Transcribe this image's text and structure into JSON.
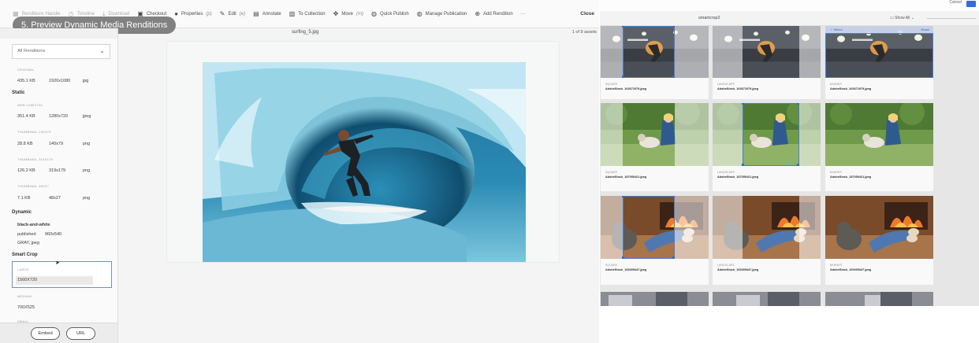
{
  "toolbar": {
    "items": [
      {
        "icon": "grid-icon",
        "label": "Renditions Handle",
        "faded": true
      },
      {
        "icon": "clock-icon",
        "label": "Timeline",
        "faded": true
      },
      {
        "icon": "download-icon",
        "label": "Download",
        "faded": true
      },
      {
        "icon": "lock-icon",
        "label": "Checkout",
        "faded": false
      },
      {
        "icon": "info-icon",
        "label": "Properties",
        "shortcut": "(p)",
        "faded": false
      },
      {
        "icon": "pencil-icon",
        "label": "Edit",
        "shortcut": "(e)",
        "faded": false
      },
      {
        "icon": "comment-icon",
        "label": "Annotate",
        "faded": false
      },
      {
        "icon": "collection-icon",
        "label": "To Collection",
        "faded": false
      },
      {
        "icon": "move-icon",
        "label": "Move",
        "shortcut": "(m)",
        "faded": false
      },
      {
        "icon": "publish-icon",
        "label": "Quick Publish",
        "faded": false
      },
      {
        "icon": "manage-publish-icon",
        "label": "Manage Publication",
        "faded": false
      },
      {
        "icon": "plus-circle-icon",
        "label": "Add Rendition",
        "faded": false
      },
      {
        "icon": "more-icon",
        "label": "···",
        "faded": false
      }
    ],
    "close_label": "Close"
  },
  "caption": "5. Preview Dynamic Media Renditions",
  "preview": {
    "filename": "surfing_5.jpg",
    "counter": "1 of 9 assets"
  },
  "sidebar": {
    "select_label": "All Renditions",
    "original_label": "ORIGINAL",
    "original": {
      "size": "435.1 KB",
      "dims": "1920x1080",
      "type": "jpg"
    },
    "static_heading": "Static",
    "static": [
      {
        "label": "WEB 1280X720",
        "size": "351.4 KB",
        "dims": "1280x720",
        "type": "jpeg"
      },
      {
        "label": "THUMBNAIL 140X79",
        "size": "28.8 KB",
        "dims": "140x79",
        "type": "png"
      },
      {
        "label": "THUMBNAIL 319X179",
        "size": "126.2 KB",
        "dims": "319x179",
        "type": "png"
      },
      {
        "label": "THUMBNAIL 48X27",
        "size": "7.1 KB",
        "dims": "48x27",
        "type": "png"
      }
    ],
    "dynamic_heading": "Dynamic",
    "dynamic": {
      "name": "black-and-white",
      "status": "published",
      "dims": "960x540",
      "format": "GRAY, jpeg"
    },
    "smartcrop_heading": "Smart Crop",
    "smartcrop": [
      {
        "label": "LARGE",
        "dims": "1560X720"
      },
      {
        "label": "MEDIUM",
        "dims": "700X525"
      },
      {
        "label": "SMALL",
        "dims": ""
      }
    ],
    "embed_label": "Embed",
    "url_label": "URL"
  },
  "right": {
    "cancel_label": "Cancel",
    "title": "smartcrop2",
    "show_all": "Show All",
    "select_label": "✓ Select",
    "reset_label": "Reset",
    "tiles": [
      {
        "label": "SQUARE",
        "name": "AdobeStock_163671979.jpeg"
      },
      {
        "label": "LANDSCAPE",
        "name": "AdobeStock_163671979.jpeg"
      },
      {
        "label": "BANNER",
        "name": "AdobeStock_163671979.jpeg"
      },
      {
        "label": "SQUARE",
        "name": "AdobeStock_187050421.jpeg"
      },
      {
        "label": "LANDSCAPE",
        "name": "AdobeStock_187050421.jpeg"
      },
      {
        "label": "BANNER",
        "name": "AdobeStock_187050421.jpeg"
      },
      {
        "label": "SQUARE",
        "name": "AdobeStock_169405447.jpeg"
      },
      {
        "label": "LANDSCAPE",
        "name": "AdobeStock_169405447.jpeg"
      },
      {
        "label": "BANNER",
        "name": "AdobeStock_169405447.jpeg"
      }
    ]
  }
}
